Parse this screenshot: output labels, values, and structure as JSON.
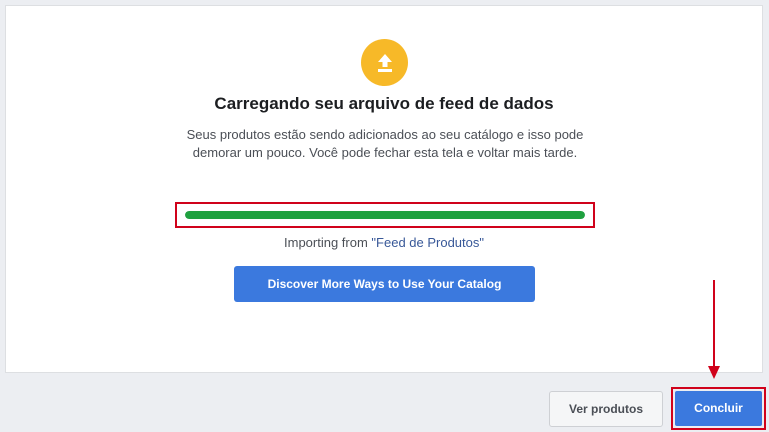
{
  "dialog": {
    "icon": "upload-icon",
    "icon_color": "#f7b928",
    "title": "Carregando seu arquivo de feed de dados",
    "description": "Seus produtos estão sendo adicionados ao seu catálogo e isso pode demorar um pouco. Você pode fechar esta tela e voltar mais tarde.",
    "progress": {
      "percent": 100,
      "color": "#1fa13f"
    },
    "import_prefix": "Importing from ",
    "import_source": "\"Feed de Produtos\"",
    "discover_button": "Discover More Ways to Use Your Catalog"
  },
  "footer": {
    "view_products_button": "Ver produtos",
    "done_button": "Concluir"
  },
  "colors": {
    "primary_button": "#3b79de",
    "highlight": "#d0021b"
  }
}
